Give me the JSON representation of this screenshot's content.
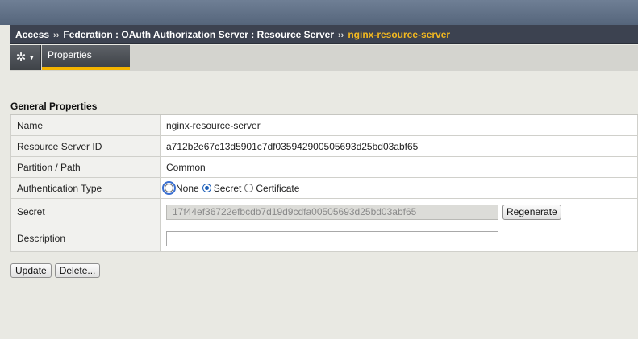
{
  "breadcrumb": {
    "items": [
      "Access",
      "Federation : OAuth Authorization Server : Resource Server"
    ],
    "current": "nginx-resource-server",
    "separator": "››"
  },
  "tabs": {
    "gear_icon": "gear-icon",
    "properties_label": "Properties"
  },
  "section": {
    "title": "General Properties"
  },
  "fields": {
    "name": {
      "label": "Name",
      "value": "nginx-resource-server"
    },
    "resource_server_id": {
      "label": "Resource Server ID",
      "value": "a712b2e67c13d5901c7df035942900505693d25bd03abf65"
    },
    "partition": {
      "label": "Partition / Path",
      "value": "Common"
    },
    "auth_type": {
      "label": "Authentication Type",
      "options": [
        "None",
        "Secret",
        "Certificate"
      ],
      "selected": "Secret"
    },
    "secret": {
      "label": "Secret",
      "value": "17f44ef36722efbcdb7d19d9cdfa00505693d25bd03abf65",
      "regenerate_label": "Regenerate"
    },
    "description": {
      "label": "Description",
      "value": ""
    }
  },
  "actions": {
    "update_label": "Update",
    "delete_label": "Delete..."
  },
  "colors": {
    "accent": "#f4b400",
    "breadcrumb_bg": "#3c4250",
    "current_crumb": "#f2b820",
    "radio_selected": "#1d5fb8"
  }
}
